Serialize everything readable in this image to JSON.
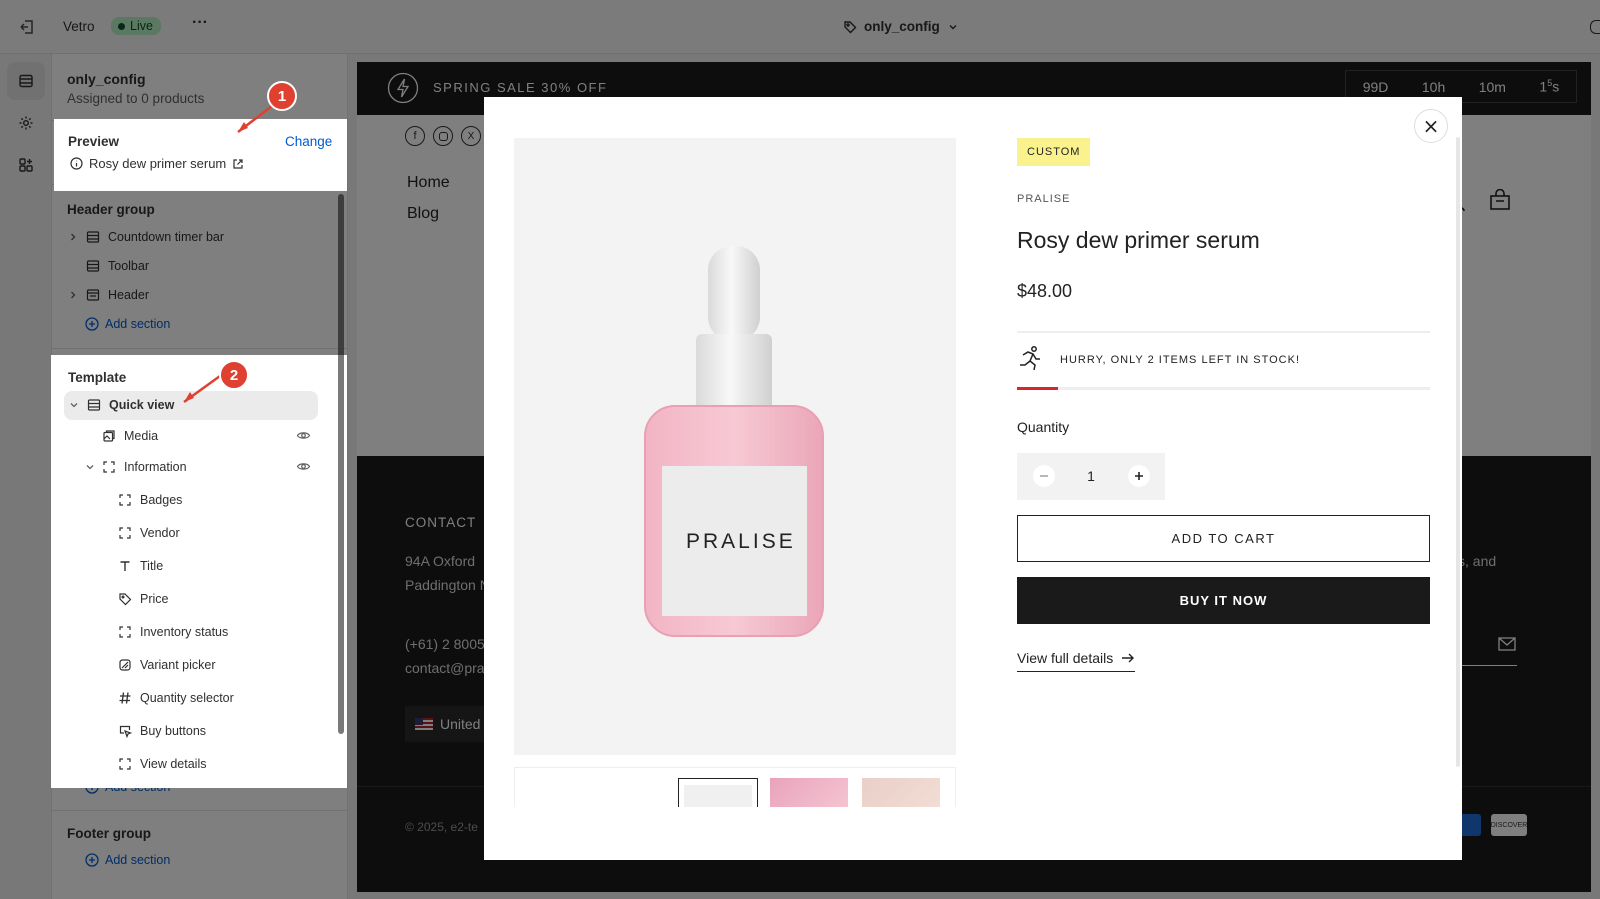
{
  "topbar": {
    "app_name": "Vetro",
    "live_badge": "Live",
    "more_label": "···",
    "template_selector": "only_config"
  },
  "sidebar": {
    "config_title": "only_config",
    "config_subtitle": "Assigned to 0 products",
    "preview_label": "Preview",
    "change_label": "Change",
    "preview_product": "Rosy dew primer serum",
    "header_group": {
      "title": "Header group",
      "items": [
        "Countdown timer bar",
        "Toolbar",
        "Header"
      ],
      "add_section": "Add section"
    },
    "template": {
      "title": "Template",
      "root": "Quick view",
      "media": "Media",
      "information": "Information",
      "blocks": [
        "Badges",
        "Vendor",
        "Title",
        "Price",
        "Inventory status",
        "Variant picker",
        "Quantity selector",
        "Buy buttons",
        "View details"
      ],
      "add_section": "Add section"
    },
    "footer_group": {
      "title": "Footer group",
      "add_section": "Add section"
    }
  },
  "annotations": {
    "marker_1": "1",
    "marker_2": "2"
  },
  "store": {
    "announcement": "SPRING SALE 30% OFF",
    "countdown": {
      "days": "99D",
      "hours": "10h",
      "minutes": "10m",
      "seconds": "1",
      "seconds_sup": "5",
      "seconds_unit": "s"
    },
    "nav": [
      "Home",
      "Blog"
    ],
    "footer_contact_heading": "CONTACT",
    "footer_address_1": "94A Oxford",
    "footer_address_2": "Paddington N",
    "footer_phone": "(+61) 2 8005",
    "footer_email": "contact@pral",
    "footer_country": "United",
    "footer_right_text": "ss, and",
    "copyright": "© 2025, e2-te",
    "payment_discover": "DISCOVER"
  },
  "modal": {
    "badge": "CUSTOM",
    "vendor": "PRALISE",
    "title": "Rosy dew primer serum",
    "price": "$48.00",
    "stock_text": "HURRY, ONLY 2 ITEMS LEFT IN STOCK!",
    "stock_level_fraction": 0.1,
    "quantity_label": "Quantity",
    "quantity_value": "1",
    "add_to_cart": "ADD TO CART",
    "buy_now": "BUY IT NOW",
    "view_details": "View full details",
    "bottle_label": "PRALISE",
    "close_label": "×"
  },
  "colors": {
    "accent_blue": "#005bd3",
    "annotation_red": "#e0402f",
    "badge_yellow": "#faf28c",
    "stock_red": "#d8262e",
    "button_black": "#1a1a1a"
  }
}
